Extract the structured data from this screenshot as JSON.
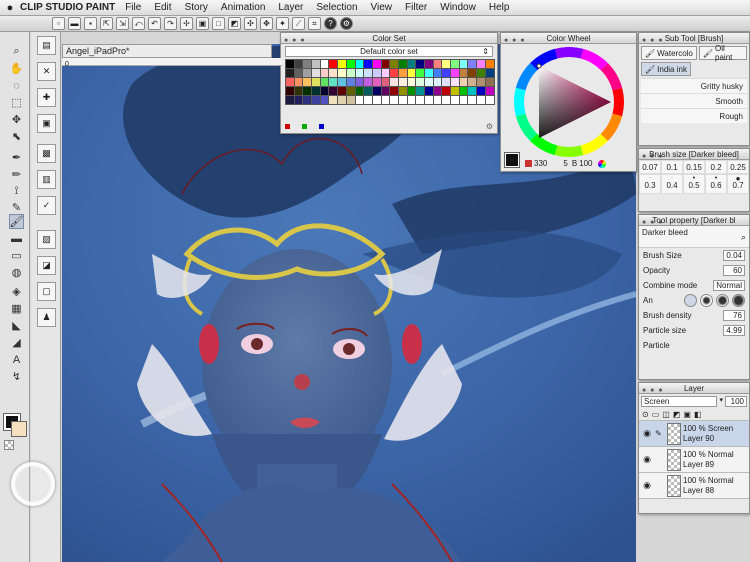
{
  "menubar": {
    "apple": "",
    "app": "CLIP STUDIO PAINT",
    "items": [
      "File",
      "Edit",
      "Story",
      "Animation",
      "Layer",
      "Selection",
      "View",
      "Filter",
      "Window",
      "Help"
    ]
  },
  "document": {
    "tab_title": "Angel_iPadPro*",
    "ruler_zero": "0"
  },
  "color_set": {
    "title": "Color Set",
    "selected_set": "Default color set",
    "colors": [
      "#000000",
      "#404040",
      "#808080",
      "#c0c0c0",
      "#ffffff",
      "#ff0000",
      "#ffff00",
      "#00ff00",
      "#00ffff",
      "#0000ff",
      "#ff00ff",
      "#800000",
      "#808000",
      "#008000",
      "#008080",
      "#000080",
      "#800080",
      "#ff8080",
      "#ffff80",
      "#80ff80",
      "#80ffff",
      "#8080ff",
      "#ff80ff",
      "#ff8000",
      "#202020",
      "#606060",
      "#a0a0a0",
      "#e0e0e0",
      "#ffcccc",
      "#ffe0cc",
      "#ffffcc",
      "#ccffcc",
      "#ccffff",
      "#cce0ff",
      "#ccccff",
      "#ffccff",
      "#ff4040",
      "#ffa040",
      "#ffff40",
      "#40ff40",
      "#40ffff",
      "#4080ff",
      "#4040ff",
      "#ff40ff",
      "#c08040",
      "#804000",
      "#408000",
      "#004080",
      "#ff6060",
      "#ff9060",
      "#ffc060",
      "#e0e060",
      "#60e060",
      "#60e0c0",
      "#60c0e0",
      "#6080e0",
      "#8060e0",
      "#c060e0",
      "#e060c0",
      "#e06080",
      "#ffe0e0",
      "#fff0e0",
      "#ffffe0",
      "#e0ffe0",
      "#e0ffff",
      "#e0f0ff",
      "#e0e0ff",
      "#ffe0ff",
      "#f0d0b0",
      "#d0b090",
      "#b09070",
      "#907050",
      "#300000",
      "#303000",
      "#003000",
      "#003030",
      "#000030",
      "#300030",
      "#600000",
      "#606000",
      "#006000",
      "#006060",
      "#000060",
      "#600060",
      "#900000",
      "#909000",
      "#009000",
      "#009090",
      "#000090",
      "#900090",
      "#c00000",
      "#c0c000",
      "#00c000",
      "#00c0c0",
      "#0000c0",
      "#c000c0",
      "#1a1a40",
      "#202060",
      "#303080",
      "#4040a0",
      "#5050c0",
      "#f0e0c0",
      "#e0d0b0",
      "#d0c0a0",
      "#ffffff",
      "#ffffff",
      "#ffffff",
      "#ffffff",
      "#ffffff",
      "#ffffff",
      "#ffffff",
      "#ffffff",
      "#ffffff",
      "#ffffff",
      "#ffffff",
      "#ffffff",
      "#ffffff",
      "#ffffff",
      "#ffffff",
      "#ffffff"
    ]
  },
  "color_wheel": {
    "title": "Color Wheel",
    "hue": "330",
    "saturation": "5",
    "brightness_label": "B",
    "brightness": "100"
  },
  "sub_tool": {
    "title": "Sub Tool [Brush]",
    "tabs": [
      "Watercolo",
      "Oil paint",
      "India ink"
    ],
    "strokes": [
      "Gritty husky",
      "Smooth",
      "Rough"
    ]
  },
  "brush_size": {
    "title": "Brush size [Darker bleed]",
    "values": [
      "0.07",
      "0.1",
      "0.15",
      "0.2",
      "0.25",
      "0.3",
      "0.4",
      "0.5",
      "0.6",
      "0.7"
    ]
  },
  "tool_property": {
    "title": "Tool property [Darker bl",
    "preset": "Darker bleed",
    "rows": [
      {
        "label": "Brush Size",
        "value": "0.04"
      },
      {
        "label": "Opacity",
        "value": "60"
      },
      {
        "label": "Combine mode",
        "value": "Normal"
      },
      {
        "label": "Brush density",
        "value": "76"
      },
      {
        "label": "Particle size",
        "value": "4.99"
      },
      {
        "label": "Particle",
        "value": ""
      }
    ],
    "aa_label": "An"
  },
  "layer": {
    "title": "Layer",
    "blend": "Screen",
    "opacity": "100",
    "rows": [
      {
        "mode": "100 % Screen",
        "name": "Layer 90"
      },
      {
        "mode": "100 % Normal",
        "name": "Layer 89"
      },
      {
        "mode": "100 % Normal",
        "name": "Layer 88"
      }
    ]
  }
}
